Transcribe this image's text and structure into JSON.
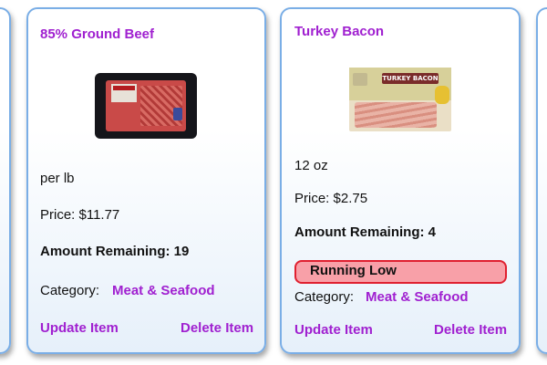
{
  "cards": [
    {
      "title": "85% Ground Beef",
      "image_icon": "ground-beef-package",
      "unit": "per lb",
      "price": "Price: $11.77",
      "amount": "Amount Remaining: 19",
      "category_label": "Category:",
      "category_value": "Meat & Seafood",
      "update_label": "Update Item",
      "delete_label": "Delete Item"
    },
    {
      "title": "Turkey Bacon",
      "image_icon": "turkey-bacon-package",
      "image_text": "TURKEY BACON",
      "unit": "12 oz",
      "price": "Price: $2.75",
      "amount": "Amount Remaining: 4",
      "status_badge": "Running Low",
      "category_label": "Category:",
      "category_value": "Meat & Seafood",
      "update_label": "Update Item",
      "delete_label": "Delete Item"
    }
  ],
  "colors": {
    "accent": "#a020d0",
    "card_border": "#7aaee6",
    "low_badge_bg": "#f8a0a8",
    "low_badge_border": "#e02030"
  }
}
